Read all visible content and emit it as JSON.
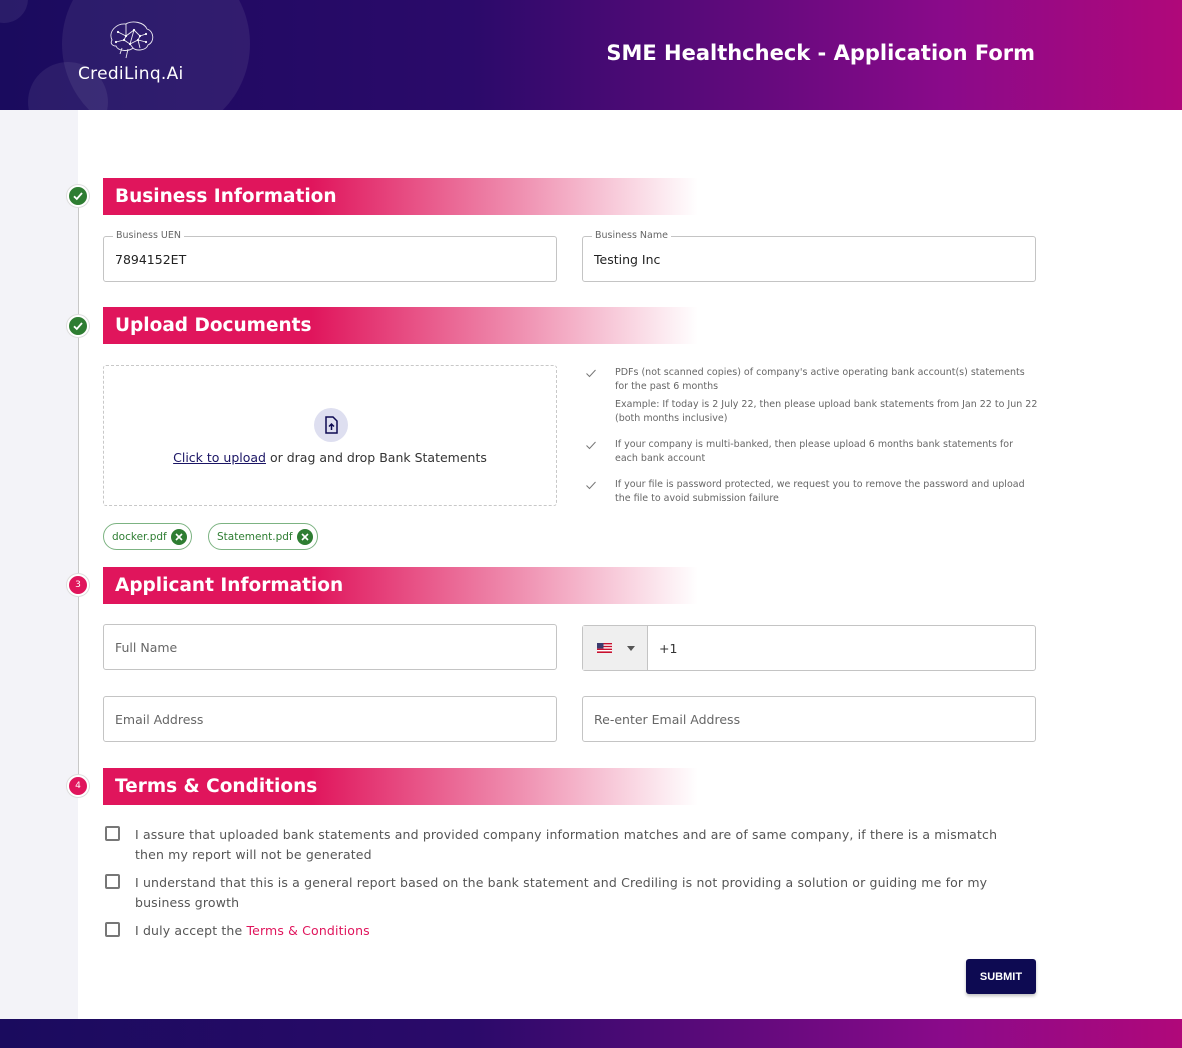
{
  "header": {
    "brand": "CrediLinq.Ai",
    "title": "SME Healthcheck - Application Form"
  },
  "steps": {
    "step3": "3",
    "step4": "4"
  },
  "sections": {
    "business": "Business Information",
    "upload": "Upload Documents",
    "applicant": "Applicant Information",
    "terms": "Terms & Conditions"
  },
  "business": {
    "uen_label": "Business UEN",
    "uen_value": "7894152ET",
    "name_label": "Business Name",
    "name_value": "Testing Inc"
  },
  "upload": {
    "link_text": "Click to upload",
    "rest_text": " or drag and drop Bank Statements",
    "hints": [
      "PDFs (not scanned copies) of company's active operating bank account(s) statements for the past 6 months",
      "Example: If today is 2 July 22, then please upload bank statements from Jan 22 to Jun 22 (both months inclusive)",
      "If your company is multi-banked, then please upload 6 months bank statements for each bank account",
      "If your file is password protected, we request you to remove the password and upload the file to avoid submission failure"
    ],
    "files": [
      "docker.pdf",
      "Statement.pdf"
    ]
  },
  "applicant": {
    "full_name_placeholder": "Full Name",
    "phone_code": "+1",
    "email_placeholder": "Email Address",
    "reemail_placeholder": "Re-enter Email Address"
  },
  "terms": {
    "item1": "I assure that uploaded bank statements and provided company information matches and are of same company, if there is a mismatch then my report will not be generated",
    "item2": "I understand that this is a general report based on the bank statement and Crediling is not providing a solution or guiding me for my business growth",
    "item3_prefix": "I duly accept the ",
    "item3_link": "Terms & Conditions"
  },
  "submit_label": "SUBMIT",
  "colors": {
    "accent": "#e0155c",
    "navy": "#0d0a52",
    "success": "#2e7d32"
  }
}
